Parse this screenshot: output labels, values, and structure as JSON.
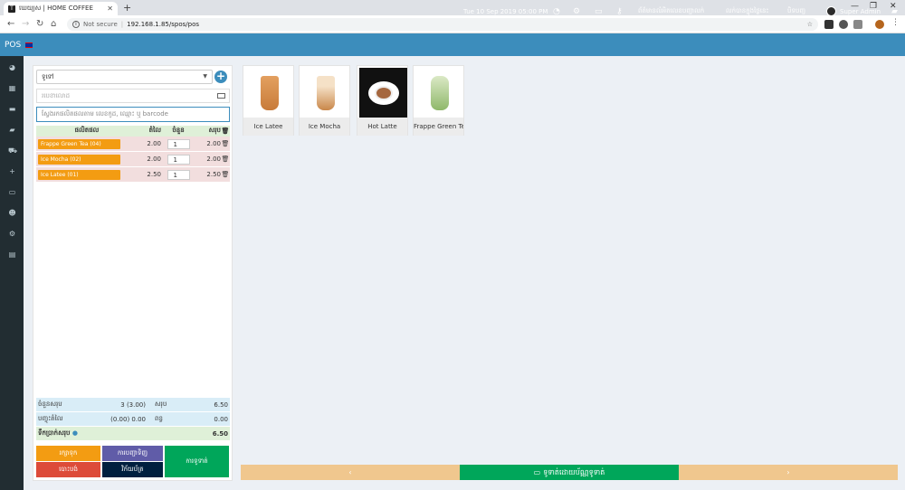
{
  "browser": {
    "tab_title": "ឃេយ្យស | HOME COFFEE",
    "tab_favicon": "T",
    "not_secure": "Not secure",
    "url": "192.168.1.85/spos/pos"
  },
  "topnav": {
    "brand": "POS",
    "datetime": "Tue 10 Sep 2019 05:00 PM",
    "link_products_alert": "ព័ត៌មានលំអិតលេខបញ្ជាលក់",
    "link_today_sales": "លក់បានក្នុងថ្ងៃនេះ",
    "link_close": "បិទបញ្ជ",
    "user": "Super Admin"
  },
  "pos": {
    "customer": "ទូទៅ",
    "note_placeholder": "របេខាលោដ",
    "search_placeholder": "ស្វែងរកផលិតផលតាម លេខកូដ, ឈ្មោះ ឬ barcode",
    "headers": {
      "product": "ផលិតផល",
      "price": "តំលៃ",
      "qty": "ចំនួន",
      "subtotal": "សរុប"
    },
    "items": [
      {
        "name": "Frappe Green Tea (04)",
        "price": "2.00",
        "qty": "1",
        "subtotal": "2.00"
      },
      {
        "name": "Ice Mocha (02)",
        "price": "2.00",
        "qty": "1",
        "subtotal": "2.00"
      },
      {
        "name": "Ice Latee (01)",
        "price": "2.50",
        "qty": "1",
        "subtotal": "2.50"
      }
    ],
    "totals": {
      "items_label": "ចំនួនសរុប",
      "items_value": "3 (3.00)",
      "total_label": "សរុប",
      "total_value": "6.50",
      "discount_label": "បញ្ចុះតំលៃ",
      "discount_value": "(0.00) 0.00",
      "tax_label": "ពន្ធ",
      "tax_value": "0.00",
      "payable_label": "ទឹកប្រាក់សរុប",
      "payable_value": "6.50"
    },
    "buttons": {
      "hold": "រក្សាទុក",
      "print_order": "ការបញ្ជាទិញ",
      "cancel": "បោះបង់",
      "print_bill": "វិក័យប័ត្រ",
      "payment": "ការទូទាត់"
    }
  },
  "products": [
    {
      "name": "Ice Latee"
    },
    {
      "name": "Ice Mocha"
    },
    {
      "name": "Hot Latte"
    },
    {
      "name": "Frappe Green Tea"
    }
  ],
  "bottom": {
    "prev": "‹",
    "pay_by_card": "ទូទាត់ដោយប័ណ្ណទូទាត់",
    "next": "›"
  },
  "colors": {
    "header": "#3c8dbc",
    "sidebar": "#222d32",
    "orange": "#f39c12",
    "red": "#dd4b39",
    "purple": "#605ca8",
    "navy": "#001f3f",
    "green": "#00a65a",
    "tan": "#f0c78e"
  }
}
